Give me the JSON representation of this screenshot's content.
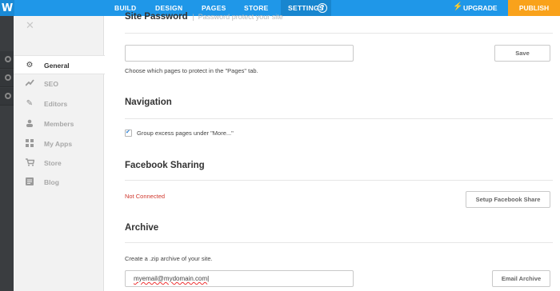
{
  "topbar": {
    "logo": "W",
    "tabs": [
      {
        "label": "BUILD"
      },
      {
        "label": "DESIGN"
      },
      {
        "label": "PAGES"
      },
      {
        "label": "STORE"
      },
      {
        "label": "SETTINGS",
        "active": true
      }
    ],
    "help": "?",
    "upgrade_label": "UPGRADE",
    "publish_label": "PUBLISH"
  },
  "sidebar": {
    "close": "✕",
    "items": [
      {
        "label": "General",
        "icon": "gear-icon",
        "active": true
      },
      {
        "label": "SEO",
        "icon": "trend-icon"
      },
      {
        "label": "Editors",
        "icon": "pencil-icon"
      },
      {
        "label": "Members",
        "icon": "person-icon"
      },
      {
        "label": "My Apps",
        "icon": "apps-grid-icon"
      },
      {
        "label": "Store",
        "icon": "cart-icon"
      },
      {
        "label": "Blog",
        "icon": "blog-icon"
      }
    ]
  },
  "password": {
    "title": "Site Password",
    "subtitle": "Password protect your site",
    "input_value": "",
    "save_label": "Save",
    "help": "Choose which pages to protect in the \"Pages\" tab."
  },
  "navigation": {
    "title": "Navigation",
    "checkbox_label": "Group excess pages under \"More...\"",
    "checked": true
  },
  "facebook": {
    "title": "Facebook Sharing",
    "status": "Not Connected",
    "setup_label": "Setup Facebook Share"
  },
  "archive": {
    "title": "Archive",
    "help": "Create a .zip archive of your site.",
    "email_value": "myemail@mydomain.com",
    "email_label": "Email Archive"
  },
  "colors": {
    "topbar": "#1f97e8",
    "publish": "#f9a21b",
    "error": "#d0382e"
  }
}
